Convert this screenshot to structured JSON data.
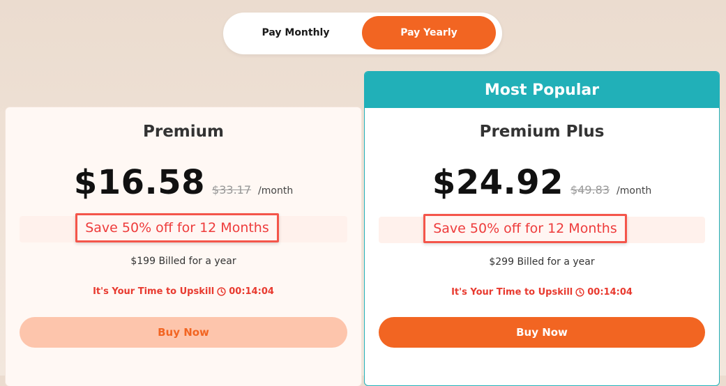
{
  "billing_toggle": {
    "monthly_label": "Pay Monthly",
    "yearly_label": "Pay Yearly",
    "selected": "yearly"
  },
  "plans": [
    {
      "name": "Premium",
      "price": "$16.58",
      "old_price": "$33.17",
      "period": "/month",
      "save_text": "Save 50% off for 12 Months",
      "billed_text": "$199 Billed for a year",
      "timer_label": "It's Your Time to Upskill",
      "timer_value": "00:14:04",
      "button_label": "Buy Now"
    },
    {
      "badge": "Most Popular",
      "name": "Premium Plus",
      "price": "$24.92",
      "old_price": "$49.83",
      "period": "/month",
      "save_text": "Save 50% off for 12 Months",
      "billed_text": "$299 Billed for a year",
      "timer_label": "It's Your Time to Upskill",
      "timer_value": "00:14:04",
      "button_label": "Buy Now"
    }
  ],
  "colors": {
    "accent": "#f26522",
    "popular": "#21b0b8",
    "highlight": "#f4554a"
  }
}
